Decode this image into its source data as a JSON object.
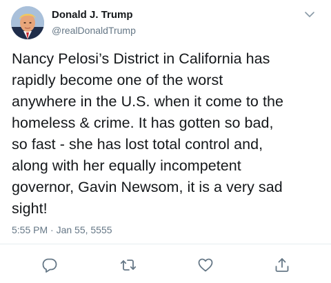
{
  "tweet": {
    "author": {
      "display_name": "Donald J. Trump",
      "handle": "@realDonaldTrump",
      "avatar_icon": "profile-photo"
    },
    "text": "Nancy Pelosi’s District in California has\nrapidly become one of the worst\nanywhere in the U.S. when it come to the\nhomeless & crime. It has gotten so bad,\nso fast - she has lost total control and,\nalong with her equally incompetent\ngovernor, Gavin Newsom, it is a very sad\nsight!",
    "timestamp": "5:55 PM · Jan 55, 5555",
    "menu_icon": "chevron-down-icon",
    "actions": [
      {
        "name": "reply",
        "icon": "reply-icon"
      },
      {
        "name": "retweet",
        "icon": "retweet-icon"
      },
      {
        "name": "like",
        "icon": "heart-icon"
      },
      {
        "name": "share",
        "icon": "share-icon"
      }
    ]
  },
  "colors": {
    "text": "#14171a",
    "secondary_text": "#657786",
    "icon": "#657786",
    "divider": "#e6ecf0",
    "background": "#ffffff"
  }
}
